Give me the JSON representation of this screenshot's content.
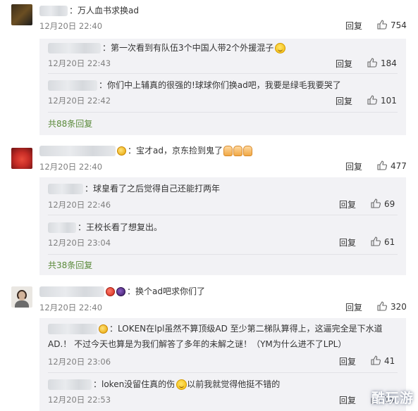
{
  "labels": {
    "reply": "回复"
  },
  "comments": [
    {
      "text": "：万人血书求换ad",
      "time": "12月20日 22:40",
      "likes": "754",
      "replies": [
        {
          "text": "：第一次看到有队伍3个中国人带2个外援混子",
          "time": "12月20日 22:43",
          "likes": "184"
        },
        {
          "text": "：你们中上辅真的很强的!球球你们换ad吧，我要是绿毛我要哭了",
          "time": "12月20日 22:42",
          "likes": "101"
        }
      ],
      "more": "共88条回复"
    },
    {
      "text": "：宝才ad，京东捡到鬼了",
      "time": "12月20日 22:40",
      "likes": "477",
      "replies": [
        {
          "text": "：球皇看了之后觉得自己还能打两年",
          "time": "12月20日 22:46",
          "likes": "69"
        },
        {
          "text": "：王校长看了想复出。",
          "time": "12月20日 23:04",
          "likes": "61"
        }
      ],
      "more": "共38条回复"
    },
    {
      "text": "：换个ad吧求你们了",
      "time": "12月20日 22:40",
      "likes": "320",
      "replies": [
        {
          "text_line1": "：LOKEN在lpl虽然不算顶级AD 至少第二梯队算得上，这逼完全是下水道",
          "text_line2": "AD.！ 不过今天也算是为我们解答了多年的未解之谜！（YM为什么进不了LPL）",
          "time": "12月20日 23:06",
          "likes": "41"
        },
        {
          "text_a": "：loken没留住真的伤",
          "text_b": "以前我就觉得他挺不错的",
          "time": "12月20日 22:53",
          "likes": "15"
        }
      ]
    }
  ],
  "watermark": "酷玩游",
  "colors": {
    "more_link": "#5a8a3a",
    "sub_bg": "#f2f2f5",
    "time": "#808080"
  }
}
